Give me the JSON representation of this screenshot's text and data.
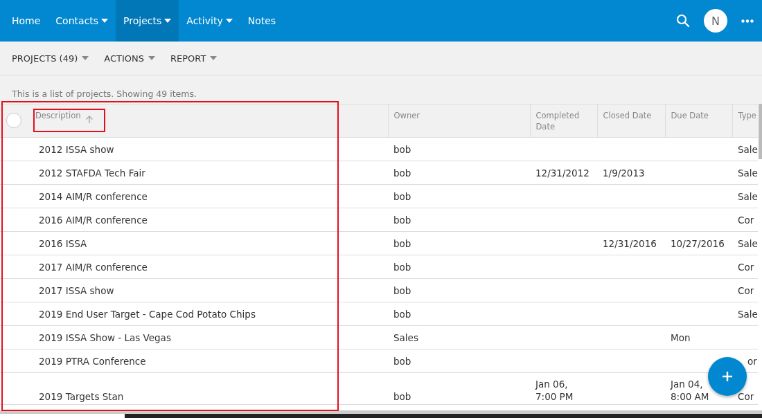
{
  "nav": {
    "items": [
      {
        "label": "Home",
        "dropdown": false,
        "selected": false
      },
      {
        "label": "Contacts",
        "dropdown": true,
        "selected": false
      },
      {
        "label": "Projects",
        "dropdown": true,
        "selected": true
      },
      {
        "label": "Activity",
        "dropdown": true,
        "selected": false
      },
      {
        "label": "Notes",
        "dropdown": false,
        "selected": false
      }
    ],
    "avatar": "N"
  },
  "toolbar": [
    "PROJECTS (49)",
    "ACTIONS",
    "REPORT"
  ],
  "caption": "This is a list of projects. Showing 49 items.",
  "table": {
    "select_all": {
      "checked": false
    },
    "columns": [
      {
        "label": "Description",
        "sorted": true
      },
      {
        "label": "Owner",
        "sorted": false
      },
      {
        "label": "Completed Date",
        "sorted": false
      },
      {
        "label": "Closed Date",
        "sorted": false
      },
      {
        "label": "Due Date",
        "sorted": false
      },
      {
        "label": "Type",
        "sorted": false
      }
    ],
    "rows": [
      [
        "2012 ISSA show",
        "bob",
        "",
        "",
        "",
        "Sale"
      ],
      [
        "2012 STAFDA Tech Fair",
        "bob",
        "12/31/2012",
        "1/9/2013",
        "",
        "Sale"
      ],
      [
        "2014 AIM/R conference",
        "bob",
        "",
        "",
        "",
        "Sale"
      ],
      [
        "2016 AIM/R conference",
        "bob",
        "",
        "",
        "",
        "Cor"
      ],
      [
        "2016 ISSA",
        "bob",
        "",
        "12/31/2016",
        "10/27/2016",
        "Sale"
      ],
      [
        "2017 AIM/R conference",
        "bob",
        "",
        "",
        "",
        "Cor"
      ],
      [
        "2017 ISSA show",
        "bob",
        "",
        "",
        "",
        "Cor"
      ],
      [
        "2019 End User Target - Cape Cod Potato Chips",
        "bob",
        "",
        "",
        "",
        "Sale"
      ],
      [
        "2019 ISSA Show - Las Vegas",
        "Sales",
        "",
        "",
        "Mon",
        ""
      ],
      [
        "2019 PTRA Conference",
        "bob",
        "",
        "",
        "",
        "or"
      ],
      [
        "2019 Targets Stan",
        "bob",
        "Jan 06, 7:00 PM",
        "",
        "Jan 04, 8:00 AM",
        "Cor"
      ]
    ]
  },
  "highlights": {
    "description_column": true,
    "description_header": true
  }
}
